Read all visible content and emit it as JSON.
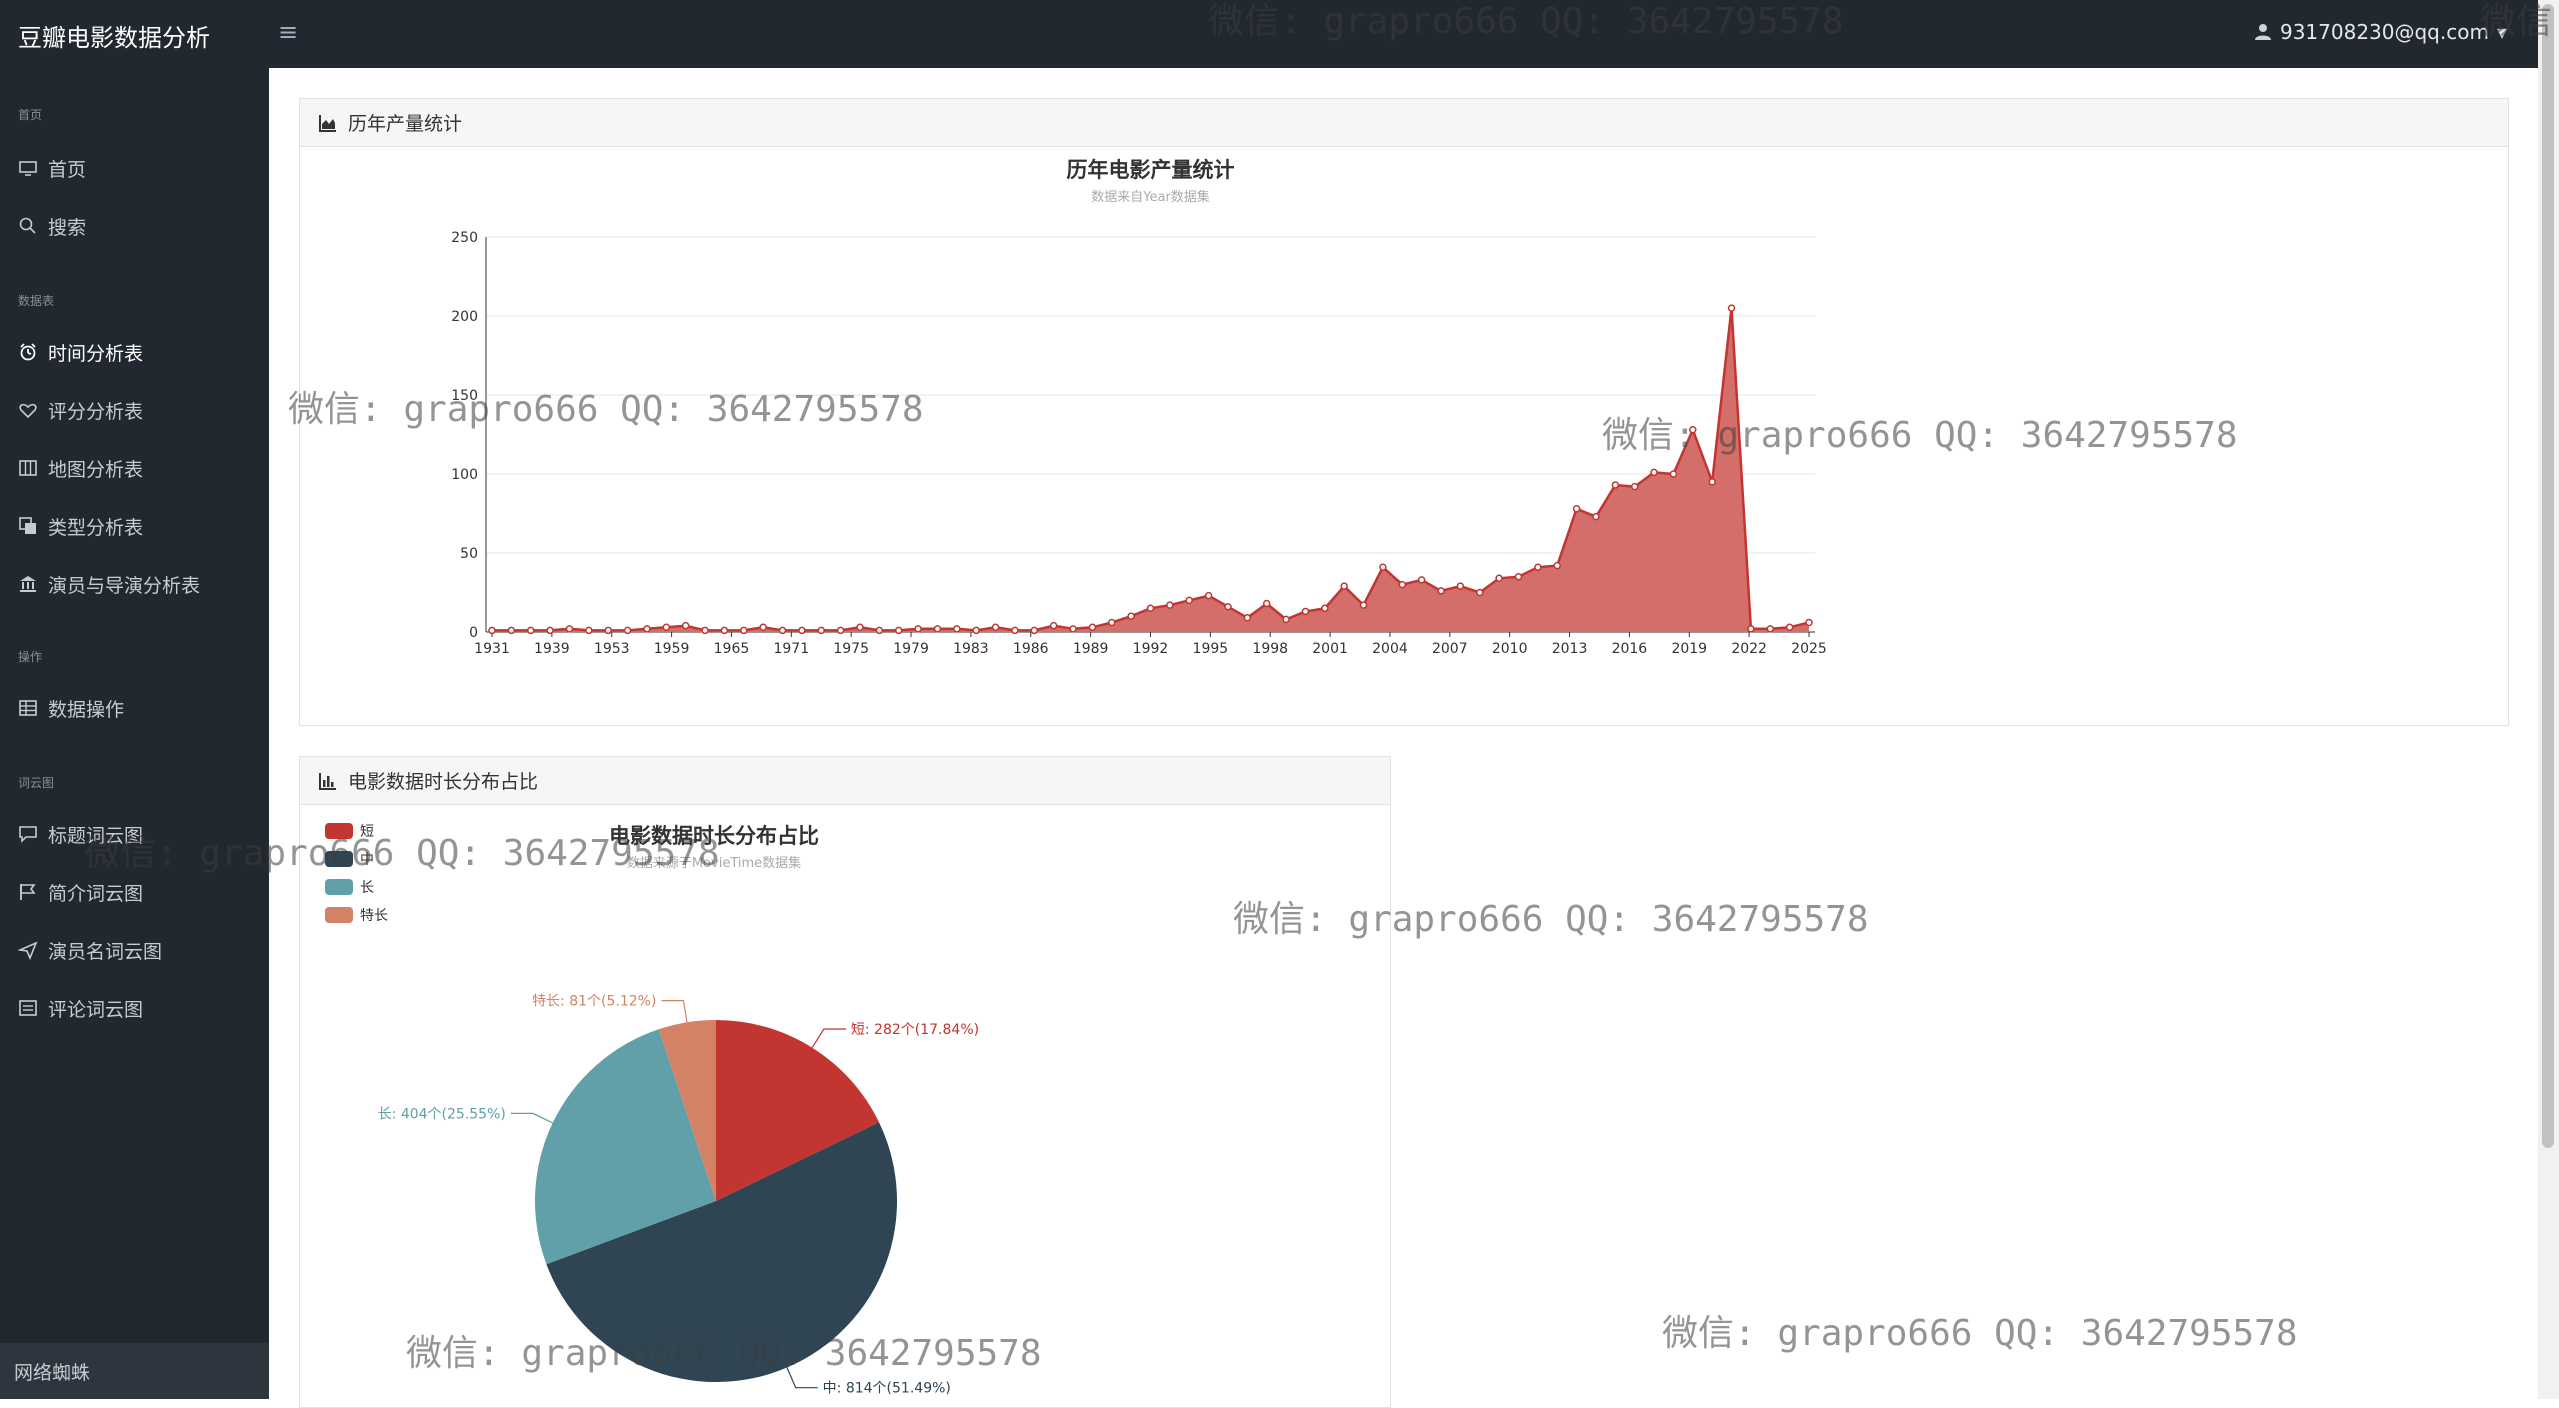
{
  "app": {
    "brand": "豆瓣电影数据分析",
    "menu_toggle": "≡",
    "user_email": "931708230@qq.com",
    "user_caret": "▾"
  },
  "sidebar": {
    "sections": [
      {
        "title": "首页"
      },
      {
        "title": "数据表"
      },
      {
        "title": "操作"
      },
      {
        "title": "词云图"
      }
    ],
    "items": [
      {
        "label": "首页",
        "icon": "monitor-icon"
      },
      {
        "label": "搜索",
        "icon": "search-icon"
      },
      {
        "label": "时间分析表",
        "icon": "alarm-clock-icon"
      },
      {
        "label": "评分分析表",
        "icon": "heart-icon"
      },
      {
        "label": "地图分析表",
        "icon": "map-icon"
      },
      {
        "label": "类型分析表",
        "icon": "copy-icon"
      },
      {
        "label": "演员与导演分析表",
        "icon": "bank-icon"
      },
      {
        "label": "数据操作",
        "icon": "table-icon"
      },
      {
        "label": "标题词云图",
        "icon": "comment-icon"
      },
      {
        "label": "简介词云图",
        "icon": "flag-icon"
      },
      {
        "label": "演员名词云图",
        "icon": "send-icon"
      },
      {
        "label": "评论词云图",
        "icon": "list-icon"
      }
    ],
    "footer": "网络蜘蛛"
  },
  "panels": {
    "year": {
      "header": "历年产量统计"
    },
    "duration": {
      "header": "电影数据时长分布占比"
    }
  },
  "watermark_text": "微信: grapro666 QQ: 3642795578",
  "chart_data": [
    {
      "type": "area",
      "title": "历年电影产量统计",
      "subtitle": "数据来自Year数据集",
      "ylim": [
        0,
        250
      ],
      "yticks": [
        0,
        50,
        100,
        150,
        200,
        250
      ],
      "xtick_labels": [
        "1931",
        "1939",
        "1953",
        "1959",
        "1965",
        "1971",
        "1975",
        "1979",
        "1983",
        "1986",
        "1989",
        "1992",
        "1995",
        "1998",
        "2001",
        "2004",
        "2007",
        "2010",
        "2013",
        "2016",
        "2019",
        "2022",
        "2025"
      ],
      "grid": true,
      "color": "#c23531",
      "fill": "#d46e6a",
      "values": [
        1,
        1,
        1,
        1,
        2,
        1,
        1,
        1,
        2,
        3,
        4,
        1,
        1,
        1,
        3,
        1,
        1,
        1,
        1,
        3,
        1,
        1,
        2,
        2,
        2,
        1,
        3,
        1,
        1,
        4,
        2,
        3,
        6,
        10,
        15,
        17,
        20,
        23,
        16,
        9,
        18,
        8,
        13,
        15,
        29,
        17,
        41,
        30,
        33,
        26,
        29,
        25,
        34,
        35,
        41,
        42,
        78,
        73,
        93,
        92,
        101,
        100,
        128,
        95,
        205,
        2,
        2,
        3,
        6
      ]
    },
    {
      "type": "pie",
      "title": "电影数据时长分布占比",
      "subtitle": "数据来源于MovieTime数据集",
      "legend_position": "top-left",
      "legend": [
        "短",
        "中",
        "长",
        "特长"
      ],
      "slices": [
        {
          "name": "短",
          "value": 282,
          "percent": "17.84%",
          "label": "短: 282个(17.84%)",
          "color": "#c23531"
        },
        {
          "name": "中",
          "value": 814,
          "percent": "51.49%",
          "label": "中: 814个(51.49%)",
          "color": "#2f4554"
        },
        {
          "name": "长",
          "value": 404,
          "percent": "25.55%",
          "label": "长: 404个(25.55%)",
          "color": "#61a0a8"
        },
        {
          "name": "特长",
          "value": 81,
          "percent": "5.12%",
          "label": "特长: 81个(5.12%)",
          "color": "#d48265"
        }
      ]
    }
  ]
}
